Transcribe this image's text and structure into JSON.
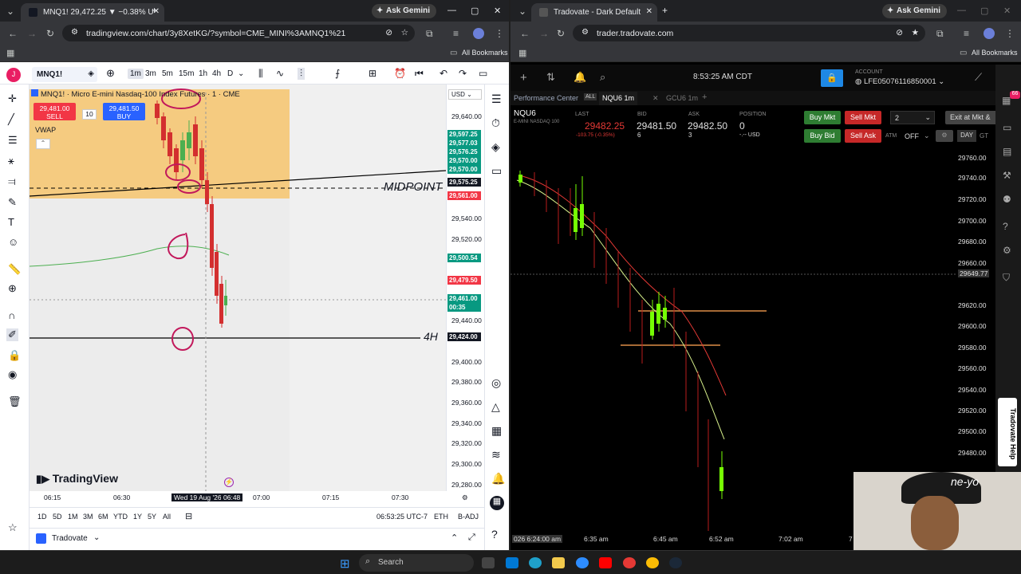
{
  "left_browser": {
    "tab_title": "MNQ1! 29,472.25 ▼ −0.38% U",
    "gemini": "Ask Gemini",
    "url": "tradingview.com/chart/3y8XetKG/?symbol=CME_MINI%3AMNQ1%21",
    "bookmarks": "All Bookmarks"
  },
  "tv": {
    "symbol": "MNQ1!",
    "timeframes": [
      "1m",
      "3m",
      "5m",
      "15m",
      "1h",
      "4h",
      "D"
    ],
    "title": "MNQ1! · Micro E-mini Nasdaq-100 Index Futures · 1 · CME",
    "currency": "USD",
    "sell_price": "29,481.00",
    "sell_label": "SELL",
    "qty": "10",
    "buy_price": "29,481.50",
    "buy_label": "BUY",
    "indicator": "VWAP",
    "midpoint_label": "MIDPOINT",
    "h4_label": "4H",
    "watermark": "TradingView",
    "price_scale": [
      "29,640.00",
      "29,540.00",
      "29,520.00",
      "29,440.00",
      "29,400.00",
      "29,380.00",
      "29,360.00",
      "29,340.00",
      "29,320.00",
      "29,300.00",
      "29,280.00"
    ],
    "badges": [
      {
        "text": "29,597.25",
        "color": "#089981"
      },
      {
        "text": "29,577.03",
        "color": "#089981"
      },
      {
        "text": "29,576.25",
        "color": "#089981"
      },
      {
        "text": "29,570.00",
        "color": "#089981"
      },
      {
        "text": "29,570.00",
        "color": "#089981"
      },
      {
        "text": "29,575.25",
        "color": "#131722"
      },
      {
        "text": "29,561.00",
        "color": "#f23645"
      },
      {
        "text": "29,500.54",
        "color": "#089981"
      },
      {
        "text": "29,479.50",
        "color": "#f23645"
      },
      {
        "text": "29,461.00",
        "color": "#089981"
      },
      {
        "text": "00:35",
        "color": "#089981"
      },
      {
        "text": "29,424.00",
        "color": "#131722"
      }
    ],
    "time_axis": [
      "06:15",
      "06:30",
      "Wed 19 Aug '26",
      "06:48",
      "07:00",
      "07:15",
      "07:30"
    ],
    "ranges": [
      "1D",
      "5D",
      "1M",
      "3M",
      "6M",
      "YTD",
      "1Y",
      "5Y",
      "All"
    ],
    "clock": "06:53:25 UTC-7",
    "session": "ETH",
    "adj": "B-ADJ",
    "broker": "Tradovate"
  },
  "right_browser": {
    "tab_title": "Tradovate - Dark Default",
    "gemini": "Ask Gemini",
    "url": "trader.tradovate.com",
    "bookmarks": "All Bookmarks"
  },
  "td": {
    "clock": "8:53:25 AM CDT",
    "account_label": "ACCOUNT",
    "account": "LFE05076116850001",
    "tabs": [
      "Performance Center",
      "ALL",
      "NQU6 1m",
      "GCU6 1m"
    ],
    "symbol": "NQU6",
    "symbol_desc": "E-MINI NASDAQ 100",
    "last_label": "LAST",
    "last": "29482.25",
    "change": "-103.75 (-0.35%)",
    "bid_label": "BID",
    "bid": "29481.50",
    "bid_size": "6",
    "ask_label": "ASK",
    "ask": "29482.50",
    "ask_size": "3",
    "pos_label": "POSITION",
    "pos": "0",
    "pos_sub": "-.-- USD",
    "buy_mkt": "Buy Mkt",
    "sell_mkt": "Sell Mkt",
    "buy_bid": "Buy Bid",
    "sell_ask": "Sell Ask",
    "qty": "2",
    "atm": "ATM",
    "atm_val": "OFF",
    "tif": "DAY",
    "tif2": "GT",
    "exit": "Exit at Mkt &",
    "price_scale": [
      "29760.00",
      "29740.00",
      "29720.00",
      "29700.00",
      "29680.00",
      "29660.00",
      "29620.00",
      "29600.00",
      "29580.00",
      "29560.00",
      "29540.00",
      "29520.00",
      "29500.00",
      "29480.00"
    ],
    "cross_price": "29649.77",
    "time_axis": [
      "026 6:24:00 am",
      "6:35 am",
      "6:45 am",
      "6:52 am",
      "7:02 am",
      "7"
    ],
    "help": "Tradovate Help",
    "badge": "66"
  },
  "video_overlay": "ne-yo",
  "taskbar": {
    "search": "Search"
  }
}
